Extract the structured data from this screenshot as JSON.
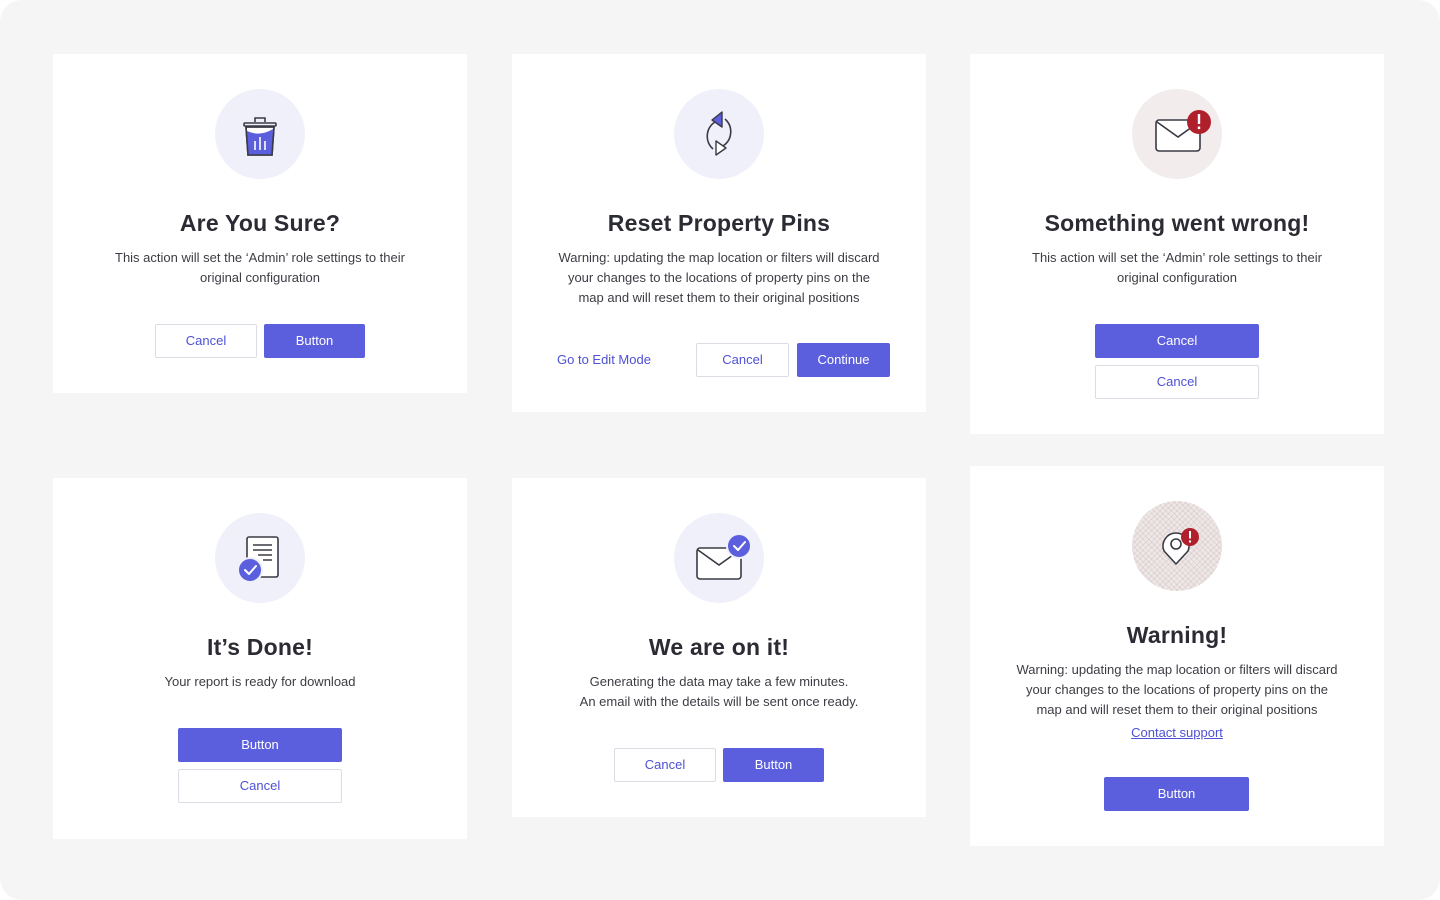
{
  "colors": {
    "accent": "#5c5fdd",
    "background": "#f5f5f6",
    "card": "#ffffff",
    "danger": "#b0202c"
  },
  "cards": [
    {
      "icon": "trash-icon",
      "title": "Are You Sure?",
      "description": [
        "This action will set the ‘Admin’ role settings to their",
        "original configuration"
      ],
      "secondary_label": "Cancel",
      "primary_label": "Button"
    },
    {
      "icon": "refresh-icon",
      "title": "Reset Property Pins",
      "description": [
        "Warning: updating the map location or filters will discard",
        "your changes to the locations of property pins on the",
        "map and will reset them to their original positions"
      ],
      "link_label": "Go to Edit Mode",
      "secondary_label": "Cancel",
      "primary_label": "Continue"
    },
    {
      "icon": "mail-error-icon",
      "title": "Something went wrong!",
      "description": [
        "This action will set the ‘Admin’ role settings to their",
        "original configuration"
      ],
      "primary_label": "Cancel",
      "secondary_label": "Cancel"
    },
    {
      "icon": "report-done-icon",
      "title": "It’s Done!",
      "description": [
        "Your report is ready for download"
      ],
      "primary_label": "Button",
      "secondary_label": "Cancel"
    },
    {
      "icon": "mail-check-icon",
      "title": "We are on it!",
      "description": [
        "Generating the data may take a few minutes.",
        "An email with the details will be sent once ready."
      ],
      "secondary_label": "Cancel",
      "primary_label": "Button"
    },
    {
      "icon": "location-warning-icon",
      "title": "Warning!",
      "description": [
        "Warning: updating the map location or filters will discard",
        "your changes to the locations of property pins on the",
        "map and will reset them to their original positions"
      ],
      "contact_label": "Contact support",
      "primary_label": "Button"
    }
  ]
}
